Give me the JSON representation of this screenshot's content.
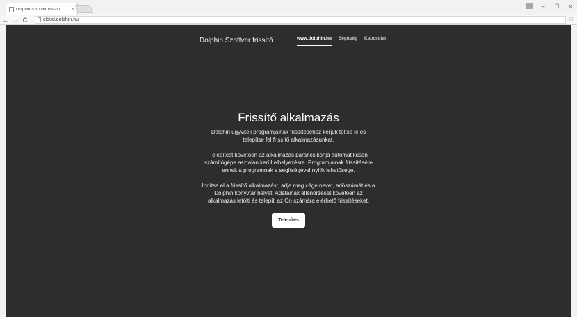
{
  "tab": {
    "title": "Dolphin Szoftver frissítő",
    "close": "×"
  },
  "window_controls": {
    "minimize": "–",
    "maximize": "◻",
    "close": "×"
  },
  "toolbar": {
    "back": "←",
    "forward": "→",
    "reload": "C",
    "url": "cloud.dolphin.hu",
    "star": "☆"
  },
  "site": {
    "brand": "Dolphin Szoftver frissítő",
    "nav": [
      {
        "label": "www.dolphin.hu",
        "active": true
      },
      {
        "label": "Segítség",
        "active": false
      },
      {
        "label": "Kapcsolat",
        "active": false
      }
    ]
  },
  "main": {
    "heading": "Frissítő alkalmazás",
    "paragraphs": [
      [
        "Dolphin ügyviteli programjainak frissítéséhez kérjük töltse le és",
        "telepítse fel frissítő alkalmazásunkat."
      ],
      [
        "Telepítést követően az alkalmazás parancsikonja automatikusan",
        "számítógépe asztalán kerül elhelyezésre. Programjainak frissítésére",
        "ennek a programnak a segítségével nyílik lehetősége."
      ],
      [
        "Indítsa el a frissítő alkalmazást, adja meg cége nevét, adószámát és a",
        "Dolphin könyvtár helyét. Adatainak ellenőrzését követően az",
        "alkalmazás letölti és telepíti az Ön számára elérhető frissítéseket."
      ]
    ],
    "install_label": "Telepítés"
  },
  "colors": {
    "page_background": "#2d2d2d",
    "text": "#ffffff",
    "button_background": "#ffffff"
  }
}
